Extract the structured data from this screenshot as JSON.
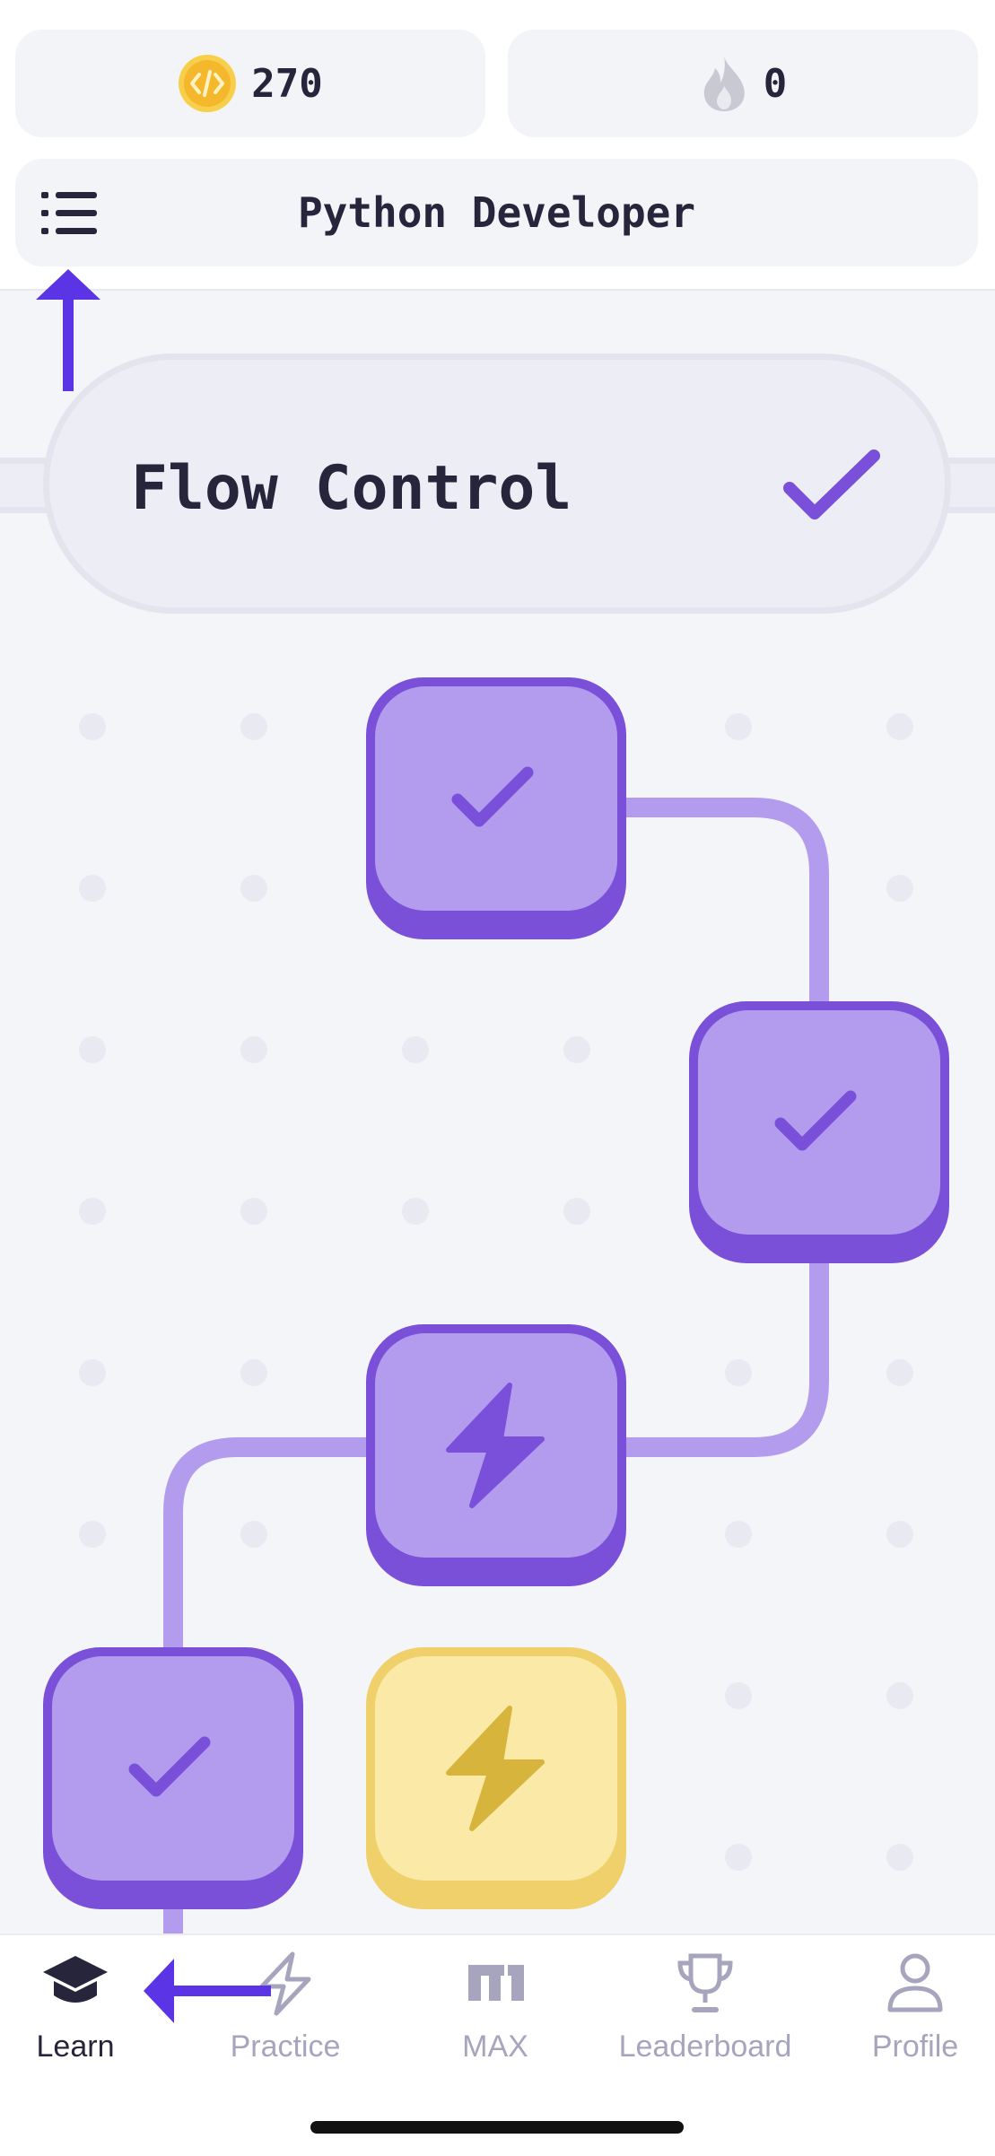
{
  "header": {
    "coins": {
      "value": "270",
      "icon": "code-coin-icon"
    },
    "streak": {
      "value": "0",
      "icon": "flame-icon"
    },
    "course_title": "Python Developer",
    "menu_icon": "list-menu-icon"
  },
  "section": {
    "title": "Flow Control",
    "status_icon": "check-icon"
  },
  "path_nodes": [
    {
      "state": "completed",
      "icon": "check-icon"
    },
    {
      "state": "completed",
      "icon": "check-icon"
    },
    {
      "state": "practice",
      "icon": "lightning-icon"
    },
    {
      "state": "completed",
      "icon": "check-icon"
    },
    {
      "state": "available",
      "icon": "lightning-icon"
    }
  ],
  "tabs": [
    {
      "label": "Learn",
      "icon": "graduation-cap-icon",
      "active": true
    },
    {
      "label": "Practice",
      "icon": "lightning-outline-icon",
      "active": false
    },
    {
      "label": "MAX",
      "icon": "max-logo-icon",
      "active": false
    },
    {
      "label": "Leaderboard",
      "icon": "trophy-icon",
      "active": false
    },
    {
      "label": "Profile",
      "icon": "person-icon",
      "active": false
    }
  ],
  "colors": {
    "accent": "#5b34e6",
    "node_purple": "#b39ced",
    "node_purple_dark": "#7a50d9",
    "node_yellow": "#fae9a7",
    "coin": "#f5b72c"
  }
}
